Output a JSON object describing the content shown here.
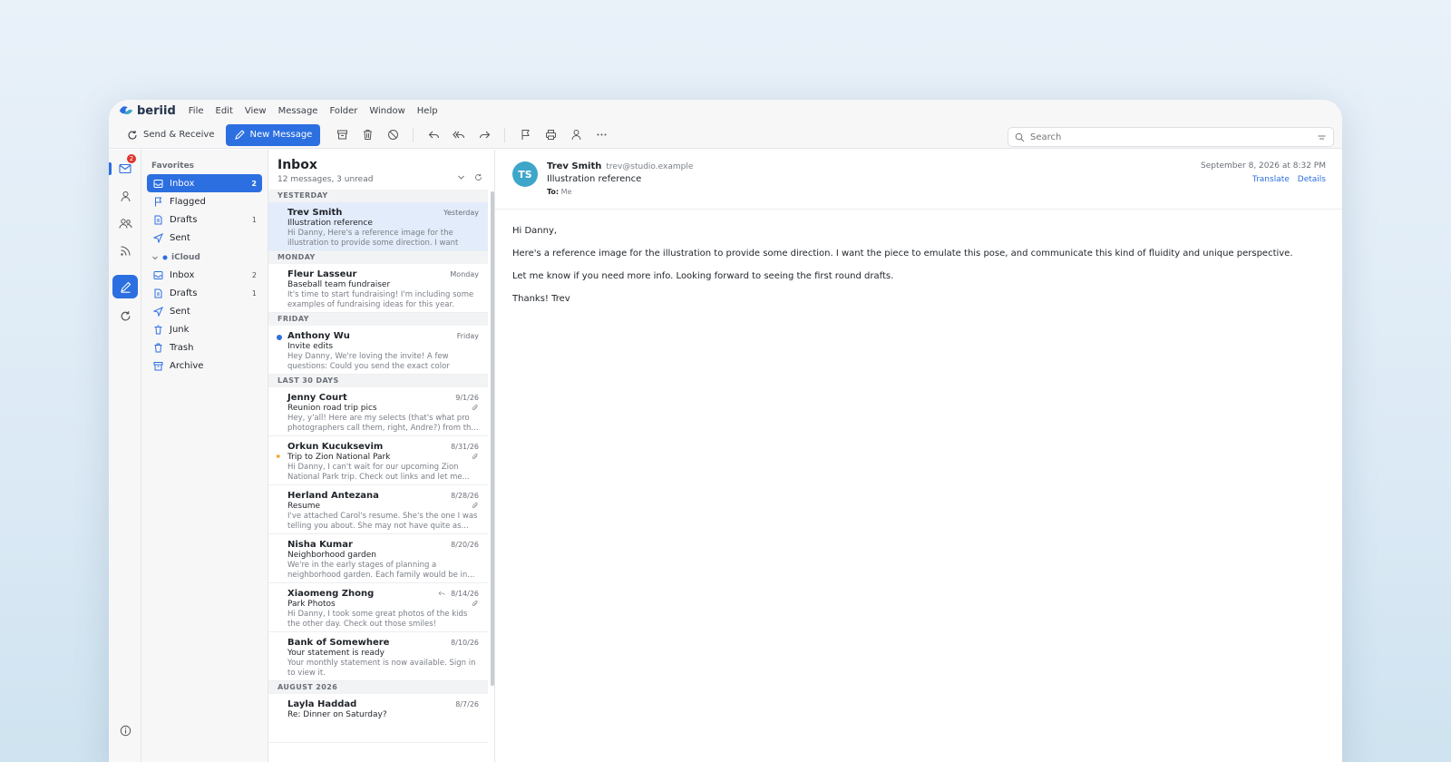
{
  "app": {
    "logo_text": "beriid"
  },
  "menu": [
    "File",
    "Edit",
    "View",
    "Message",
    "Folder",
    "Window",
    "Help"
  ],
  "toolbar": {
    "send_receive": "Send & Receive",
    "new_message": "New Message"
  },
  "search": {
    "placeholder": "Search"
  },
  "rail": {
    "mail_badge": "2"
  },
  "sidebar": {
    "favorites_heading": "Favorites",
    "favorites": [
      {
        "label": "Inbox",
        "count": "2"
      },
      {
        "label": "Flagged",
        "count": ""
      },
      {
        "label": "Drafts",
        "count": "1"
      },
      {
        "label": "Sent",
        "count": ""
      }
    ],
    "account_name": "iCloud",
    "account_folders": [
      {
        "label": "Inbox",
        "count": "2"
      },
      {
        "label": "Drafts",
        "count": "1"
      },
      {
        "label": "Sent",
        "count": ""
      },
      {
        "label": "Junk",
        "count": ""
      },
      {
        "label": "Trash",
        "count": ""
      },
      {
        "label": "Archive",
        "count": ""
      }
    ]
  },
  "list": {
    "title": "Inbox",
    "subtitle": "12 messages, 3 unread",
    "groups": {
      "yesterday": "YESTERDAY",
      "monday": "MONDAY",
      "friday": "FRIDAY",
      "last30": "LAST 30 DAYS",
      "august": "AUGUST 2026"
    },
    "messages": [
      {
        "from": "Trev Smith",
        "date": "Yesterday",
        "subject": "Illustration reference",
        "preview": "Hi Danny, Here's a reference image for the illustration to provide some direction. I want the..."
      },
      {
        "from": "Fleur Lasseur",
        "date": "Monday",
        "subject": "Baseball team fundraiser",
        "preview": "It's time to start fundraising! I'm including some examples of fundraising ideas for this year. Let's..."
      },
      {
        "from": "Anthony Wu",
        "date": "Friday",
        "subject": "Invite edits",
        "preview": "Hey Danny, We're loving the invite! A few questions: Could you send the exact color codes..."
      },
      {
        "from": "Jenny Court",
        "date": "9/1/26",
        "subject": "Reunion road trip pics",
        "preview": "Hey, y'all! Here are my selects (that's what pro photographers call them, right, Andre?) from th..."
      },
      {
        "from": "Orkun Kucuksevim",
        "date": "8/31/26",
        "subject": "Trip to Zion National Park",
        "preview": "Hi Danny, I can't wait for our upcoming Zion National Park trip. Check out links and let me..."
      },
      {
        "from": "Herland Antezana",
        "date": "8/28/26",
        "subject": "Resume",
        "preview": "I've attached Carol's resume. She's the one I was telling you about. She may not have quite as..."
      },
      {
        "from": "Nisha Kumar",
        "date": "8/20/26",
        "subject": "Neighborhood garden",
        "preview": "We're in the early stages of planning a neighborhood garden. Each family would be in..."
      },
      {
        "from": "Xiaomeng Zhong",
        "date": "8/14/26",
        "subject": "Park Photos",
        "preview": "Hi Danny, I took some great photos of the kids the other day. Check out those smiles!"
      },
      {
        "from": "Bank of Somewhere",
        "date": "8/10/26",
        "subject": "Your statement is ready",
        "preview": "Your monthly statement is now available. Sign in to view it."
      },
      {
        "from": "Layla Haddad",
        "date": "8/7/26",
        "subject": "Re: Dinner on Saturday?",
        "preview": ""
      }
    ]
  },
  "reader": {
    "avatar_initials": "TS",
    "from": "Trev Smith",
    "email": "trev@studio.example",
    "subject": "Illustration reference",
    "to_label": "To:",
    "to_value": "Me",
    "date": "September 8, 2026 at 8:32 PM",
    "translate": "Translate",
    "details": "Details",
    "body": [
      "Hi Danny,",
      "Here's a reference image for the illustration to provide some direction. I want the piece to emulate this pose, and communicate this kind of fluidity and unique perspective.",
      "Let me know if you need more info. Looking forward to seeing the first round drafts.",
      "Thanks! Trev"
    ]
  },
  "colors": {
    "accent": "#2c6fe0",
    "avatar": "#3ea6c9",
    "badge": "#e0342e",
    "flag": "#f0a020"
  }
}
